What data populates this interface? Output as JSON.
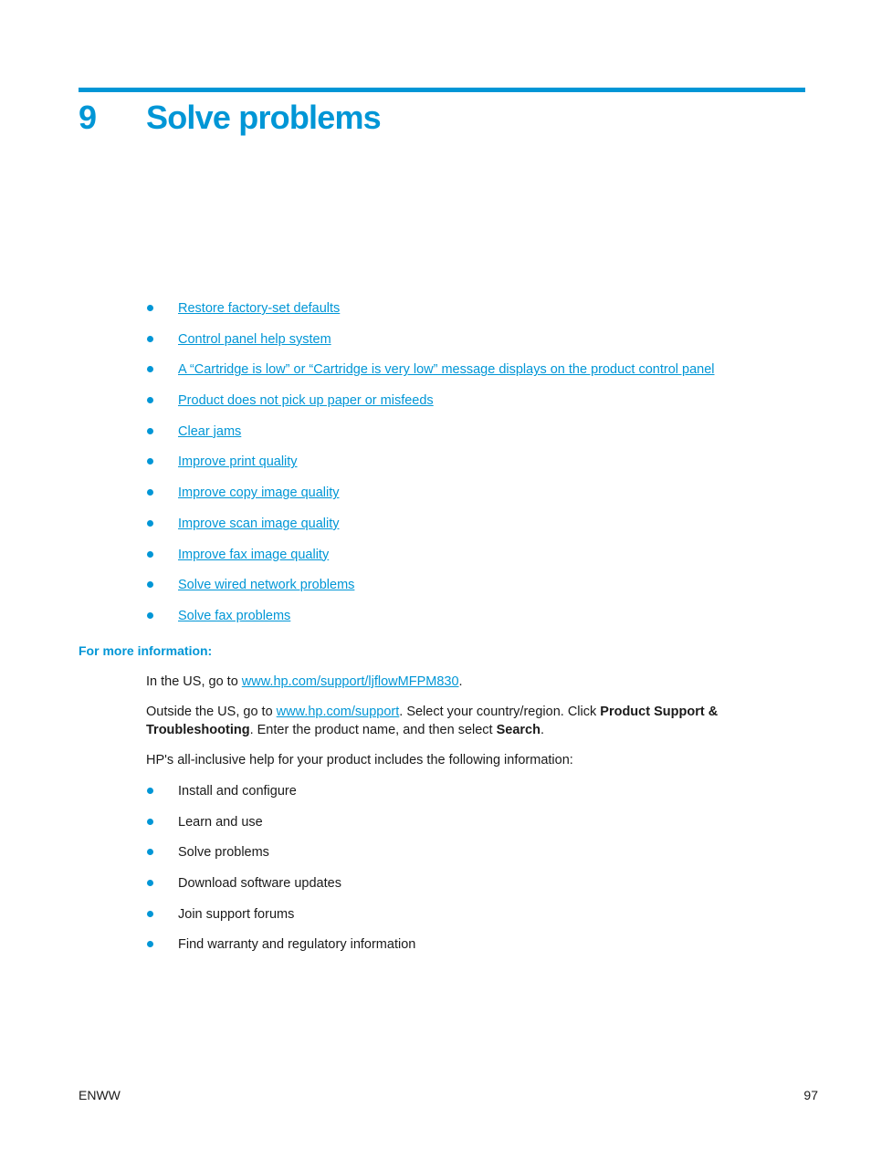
{
  "header": {
    "chapter_number": "9",
    "chapter_title": "Solve problems"
  },
  "topic_links": [
    {
      "label": "Restore factory-set defaults"
    },
    {
      "label": "Control panel help system"
    },
    {
      "label": "A “Cartridge is low” or “Cartridge is very low” message displays on the product control panel"
    },
    {
      "label": "Product does not pick up paper or misfeeds"
    },
    {
      "label": "Clear jams"
    },
    {
      "label": "Improve print quality"
    },
    {
      "label": "Improve copy image quality"
    },
    {
      "label": "Improve scan image quality"
    },
    {
      "label": "Improve fax image quality"
    },
    {
      "label": "Solve wired network problems"
    },
    {
      "label": "Solve fax problems"
    }
  ],
  "more_info": {
    "heading": "For more information:",
    "us_prefix": "In the US, go to ",
    "us_link": "www.hp.com/support/ljflowMFPM830",
    "us_suffix": ".",
    "outside_prefix": "Outside the US, go to ",
    "outside_link": "www.hp.com/support",
    "outside_mid1": ". Select your country/region. Click ",
    "outside_bold1": "Product Support & Troubleshooting",
    "outside_mid2": ". Enter the product name, and then select ",
    "outside_bold2": "Search",
    "outside_suffix": ".",
    "includes_intro": "HP's all-inclusive help for your product includes the following information:",
    "items": [
      {
        "label": "Install and configure"
      },
      {
        "label": "Learn and use"
      },
      {
        "label": "Solve problems"
      },
      {
        "label": "Download software updates"
      },
      {
        "label": "Join support forums"
      },
      {
        "label": "Find warranty and regulatory information"
      }
    ]
  },
  "footer": {
    "left": "ENWW",
    "page_number": "97"
  },
  "colors": {
    "accent": "#0096d6",
    "text": "#1a1a1a"
  }
}
